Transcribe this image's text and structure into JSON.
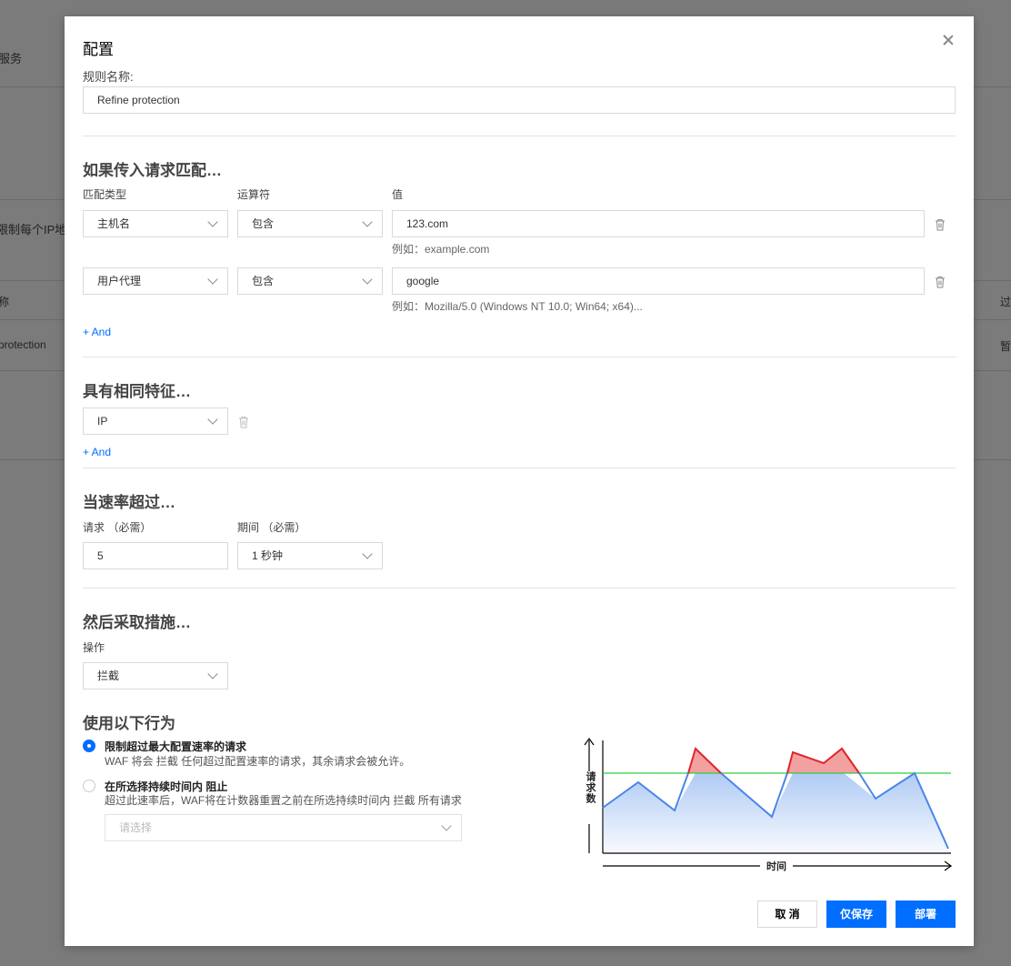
{
  "background": {
    "tab_fragment": "服务",
    "row_label_fragment": "限制每个IP地",
    "col_name_fragment": "称",
    "col_right_fragment": "过",
    "row_name_fragment": "protection",
    "row_right_fragment": "暂"
  },
  "modal": {
    "title": "配置",
    "rule_name_label": "规则名称:",
    "rule_name_value": "Refine protection",
    "match": {
      "title": "如果传入请求匹配…",
      "col_type": "匹配类型",
      "col_operator": "运算符",
      "col_value": "值",
      "rows": [
        {
          "type": "主机名",
          "operator": "包含",
          "value": "123.com",
          "hint": "例如：example.com"
        },
        {
          "type": "用户代理",
          "operator": "包含",
          "value": "google",
          "hint": "例如：Mozilla/5.0 (Windows NT 10.0; Win64; x64)..."
        }
      ],
      "add_label": "+ And"
    },
    "characteristics": {
      "title": "具有相同特征…",
      "value": "IP",
      "add_label": "+ And"
    },
    "rate": {
      "title": "当速率超过…",
      "requests_label": "请求 （必需）",
      "requests_value": "5",
      "period_label": "期间 （必需）",
      "period_value": "1 秒钟"
    },
    "action": {
      "title": "然后采取措施…",
      "label": "操作",
      "value": "拦截"
    },
    "behavior": {
      "title": "使用以下行为",
      "option1_title": "限制超过最大配置速率的请求",
      "option1_desc": "WAF 将会 拦截 任何超过配置速率的请求，其余请求会被允许。",
      "option1_checked": true,
      "option2_title": "在所选择持续时间内 阻止",
      "option2_desc": "超过此速率后，WAF将在计数器重置之前在所选持续时间内 拦截 所有请求",
      "option2_placeholder": "请选择",
      "option2_checked": false
    },
    "diagram": {
      "y_label": "请求数",
      "x_label": "时间",
      "threshold_color": "#2ecc40",
      "under_color": "#4a86e8",
      "over_color": "#e0242a"
    },
    "buttons": {
      "cancel": "取 消",
      "save_only": "仅保存",
      "deploy": "部署"
    }
  }
}
